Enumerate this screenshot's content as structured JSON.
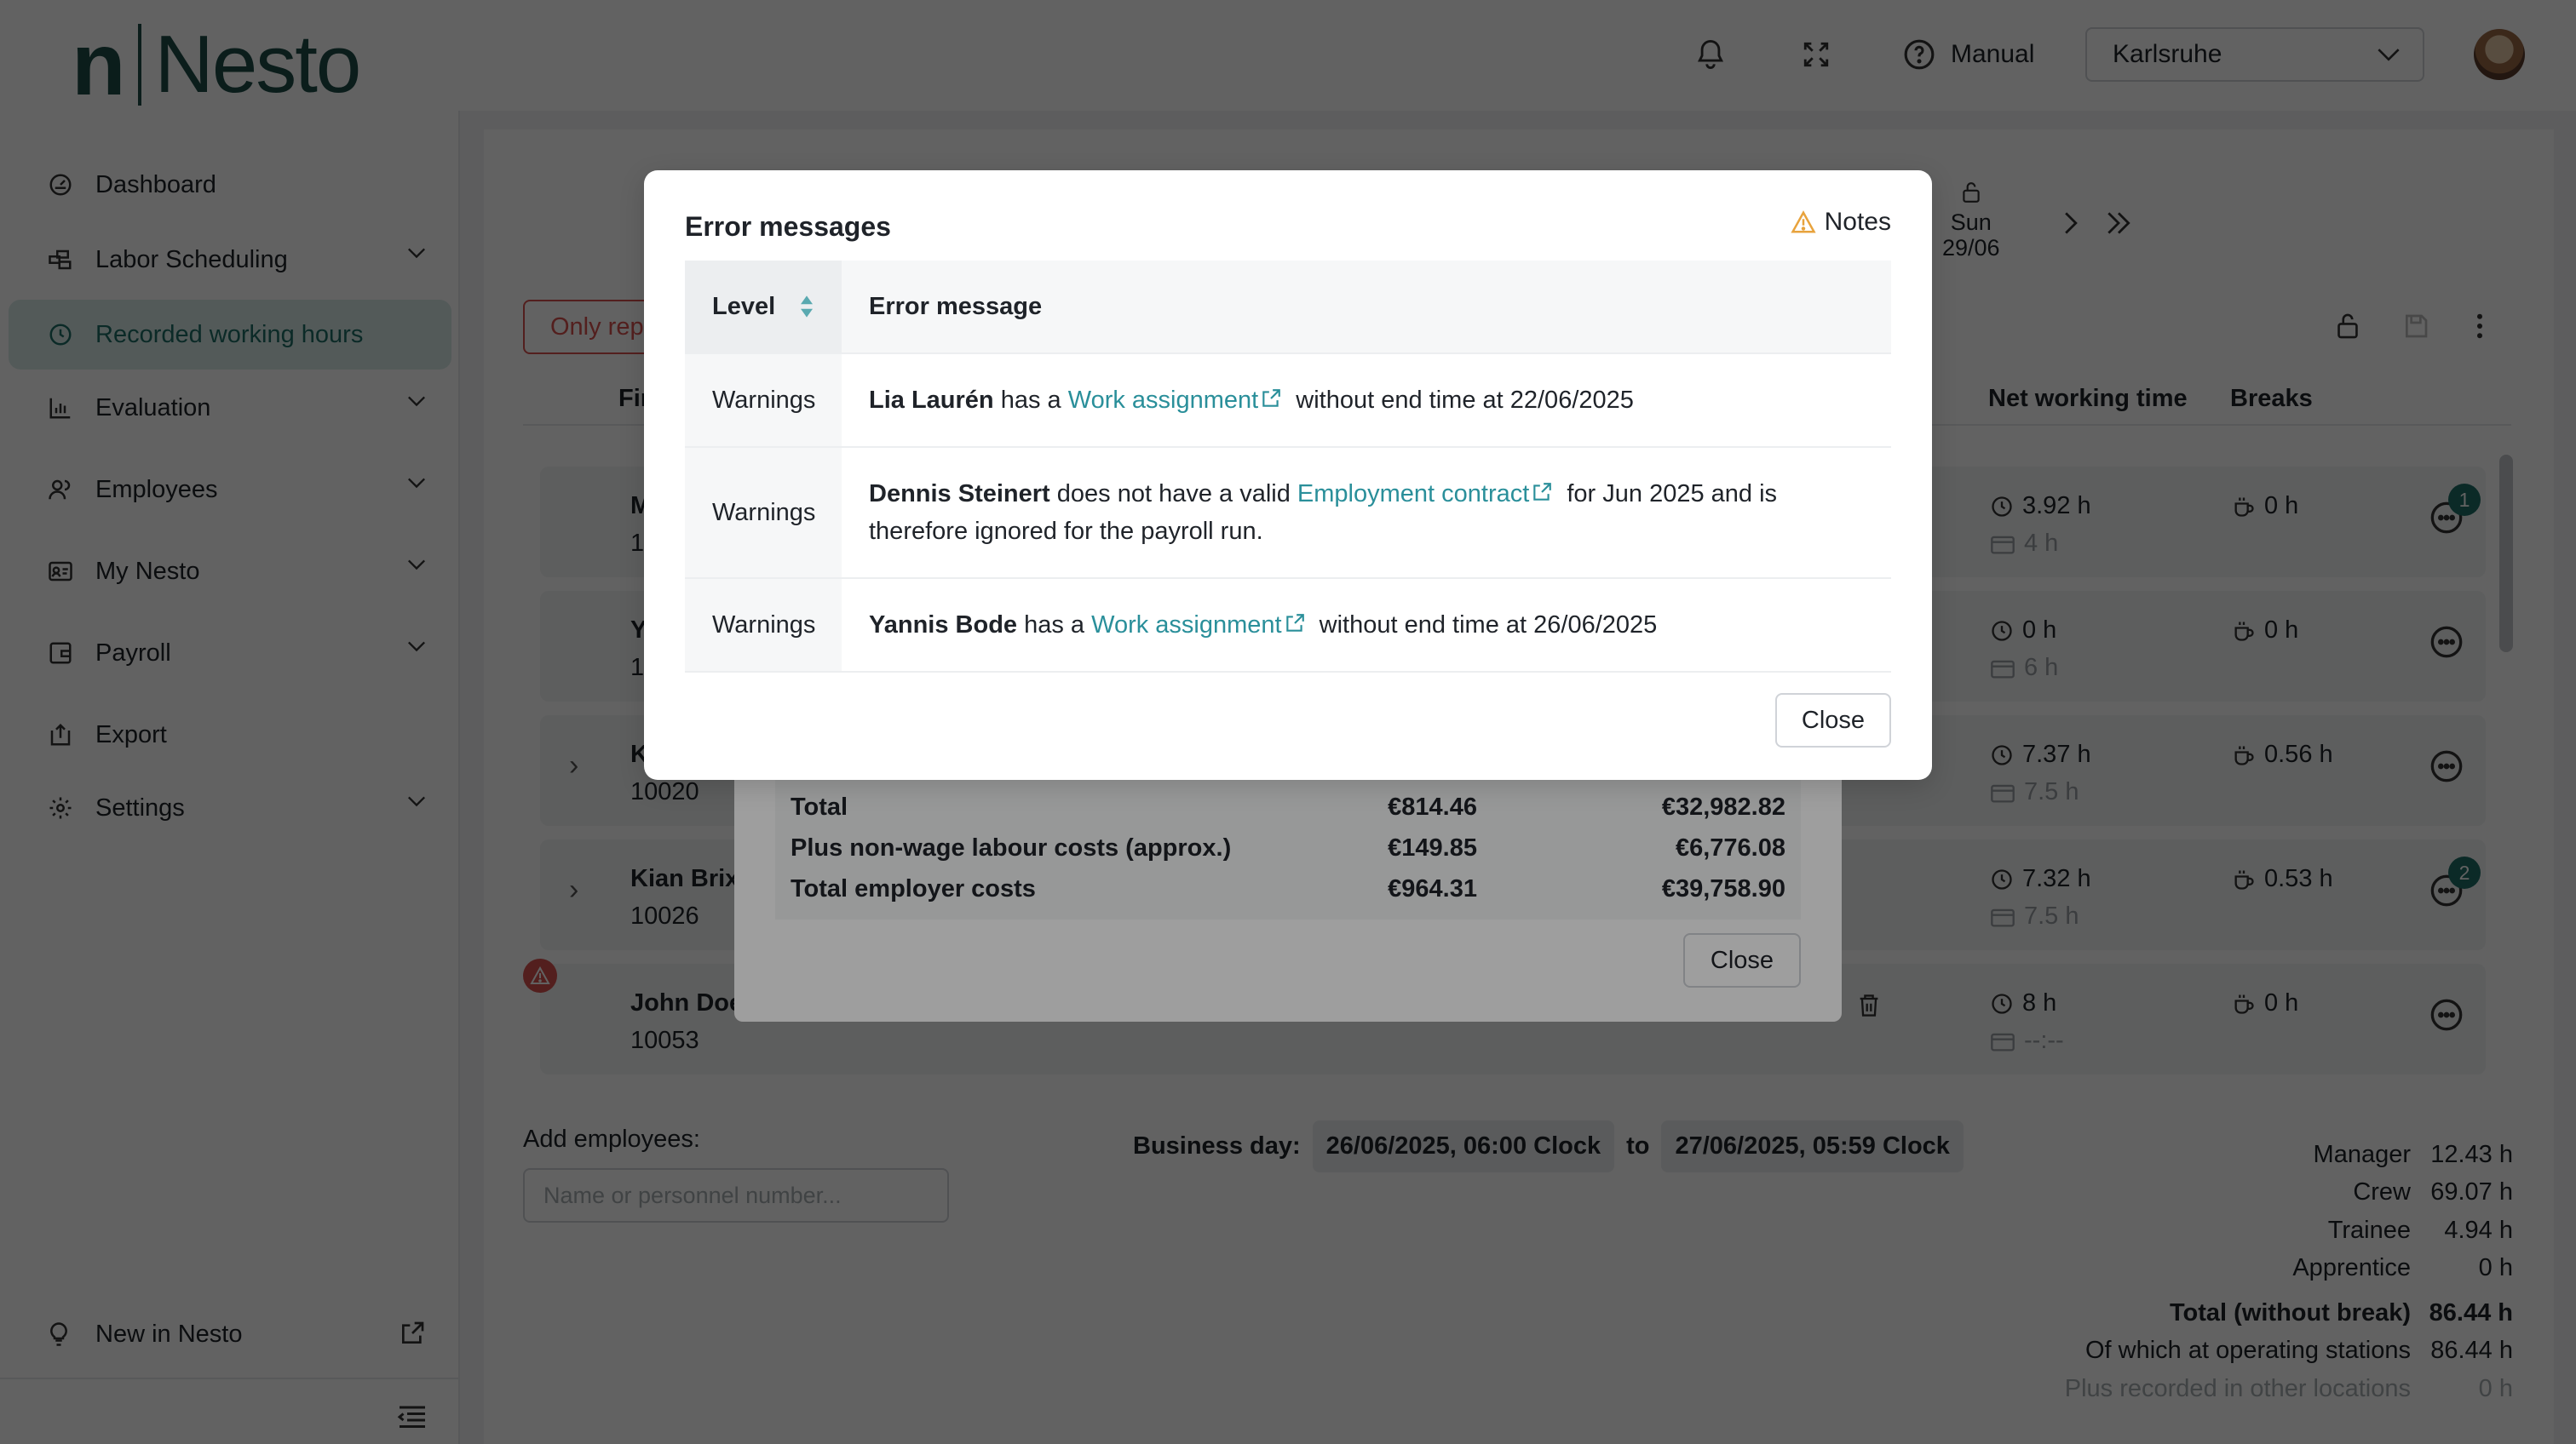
{
  "app": {
    "logo_mark": "n",
    "logo_word": "Nesto"
  },
  "header": {
    "manual_label": "Manual",
    "location": "Karlsruhe"
  },
  "sidebar": {
    "items": [
      {
        "label": "Dashboard"
      },
      {
        "label": "Labor Scheduling"
      },
      {
        "label": "Recorded working hours"
      },
      {
        "label": "Evaluation"
      },
      {
        "label": "Employees"
      },
      {
        "label": "My Nesto"
      },
      {
        "label": "Payroll"
      },
      {
        "label": "Export"
      },
      {
        "label": "Settings"
      }
    ],
    "new_label": "New in Nesto"
  },
  "week_nav": {
    "day": "Sun",
    "date": "29/06"
  },
  "filter_chip": "Only rep",
  "table": {
    "col_first": "Fir",
    "col_net": "Net working time",
    "col_breaks": "Breaks",
    "rows": [
      {
        "name": "M",
        "id": "1",
        "net": "3.92 h",
        "plan": "4 h",
        "breaks": "0 h",
        "badge": "1"
      },
      {
        "name": "Y",
        "id": "1",
        "net": "0 h",
        "plan": "6 h",
        "breaks": "0 h",
        "badge": ""
      },
      {
        "name": "K",
        "id": "10020",
        "net": "7.37 h",
        "plan": "7.5 h",
        "breaks": "0.56 h",
        "badge": ""
      },
      {
        "name": "Kian Brix",
        "id": "10026",
        "net": "7.32 h",
        "plan": "7.5 h",
        "breaks": "0.53 h",
        "badge": "2"
      },
      {
        "name": "John Doe",
        "id": "10053",
        "net": "8 h",
        "plan": "--:--",
        "breaks": "0 h",
        "badge": ""
      }
    ]
  },
  "add_employees": {
    "label": "Add employees:",
    "placeholder": "Name or personnel number..."
  },
  "business_day": {
    "label": "Business day:",
    "from": "26/06/2025, 06:00 Clock",
    "to_word": "to",
    "to": "27/06/2025, 05:59 Clock"
  },
  "summary": [
    {
      "label": "Manager",
      "value": "12.43 h"
    },
    {
      "label": "Crew",
      "value": "69.07 h"
    },
    {
      "label": "Trainee",
      "value": "4.94 h"
    },
    {
      "label": "Apprentice",
      "value": "0 h"
    },
    {
      "label": "Total (without break)",
      "value": "86.44 h"
    },
    {
      "label": "Of which at operating stations",
      "value": "86.44 h"
    },
    {
      "label": "Plus recorded in other locations",
      "value": "0 h"
    }
  ],
  "cost_modal": {
    "rows": [
      {
        "label": "Total",
        "day": "€814.46",
        "month": "€32,982.82"
      },
      {
        "label": "Plus non-wage labour costs (approx.)",
        "day": "€149.85",
        "month": "€6,776.08"
      },
      {
        "label": "Total employer costs",
        "day": "€964.31",
        "month": "€39,758.90"
      }
    ],
    "close_label": "Close"
  },
  "error_modal": {
    "title": "Error messages",
    "notes_label": "Notes",
    "col_level": "Level",
    "col_message": "Error message",
    "rows": [
      {
        "level": "Warnings",
        "name": "Lia Laurén",
        "pre": " has a ",
        "link": "Work assignment",
        "post": " without end time at 22/06/2025"
      },
      {
        "level": "Warnings",
        "name": "Dennis Steinert",
        "pre": " does not have a valid ",
        "link": "Employment contract",
        "post": " for Jun 2025 and is therefore ignored for the payroll run."
      },
      {
        "level": "Warnings",
        "name": "Yannis Bode",
        "pre": " has a ",
        "link": "Work assignment",
        "post": " without end time at 26/06/2025"
      }
    ],
    "close_label": "Close"
  },
  "colors": {
    "brand": "#1e4d49",
    "accent": "#1e6e67",
    "link": "#2a8f9a",
    "danger": "#d9534f",
    "warning": "#e8a33d"
  }
}
